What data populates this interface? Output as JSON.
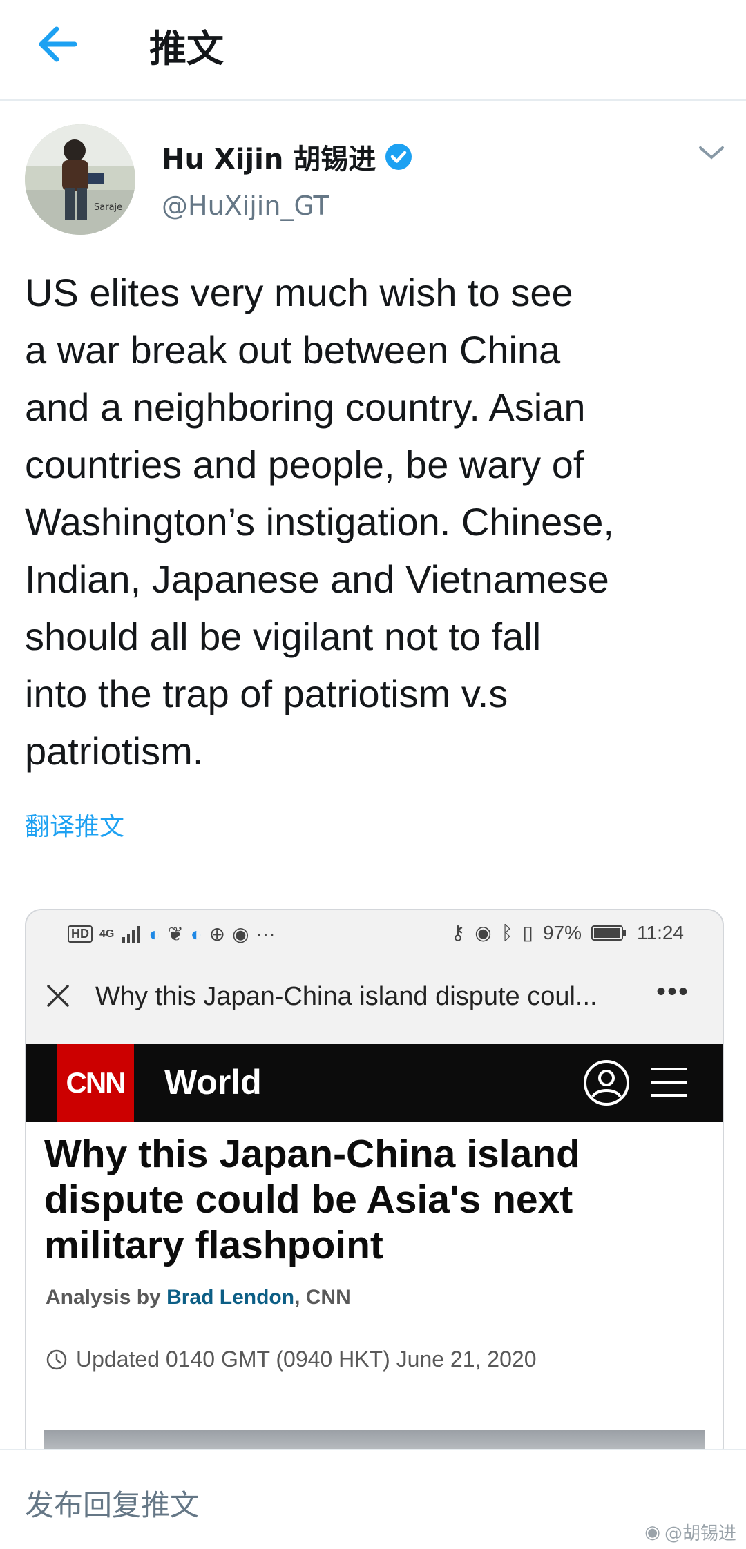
{
  "header": {
    "title": "推文"
  },
  "tweet": {
    "author_name": "Hu Xijin 胡锡进",
    "handle": "@HuXijin_GT",
    "text": "US elites very much wish to see\na war break out between China\nand a neighboring country. Asian\ncountries and people, be wary of\nWashington’s instigation. Chinese,\nIndian, Japanese and Vietnamese\nshould all be vigilant not to fall\ninto the trap of patriotism v.s\npatriotism.",
    "translate_label": "翻译推文",
    "avatar_caption": "Saraje"
  },
  "card": {
    "phone_status_left": "4G",
    "battery": "97%",
    "time": "11:24",
    "browser_title": "Why this Japan-China island dispute coul...",
    "browser_more": "•••",
    "cnn_logo": "CNN",
    "cnn_section": "World",
    "headline": "Why this Japan-China island dispute could be Asia's next military flashpoint",
    "byline_prefix": "Analysis by ",
    "byline_author": "Brad Lendon",
    "byline_suffix": ", CNN",
    "updated": "Updated 0140 GMT (0940 HKT) June 21, 2020"
  },
  "reply": {
    "placeholder": "发布回复推文"
  },
  "watermark": {
    "text": "@胡锡进"
  },
  "colors": {
    "accent": "#1da1f2",
    "cnn_red": "#cc0000",
    "text": "#14171a",
    "muted": "#657786"
  }
}
